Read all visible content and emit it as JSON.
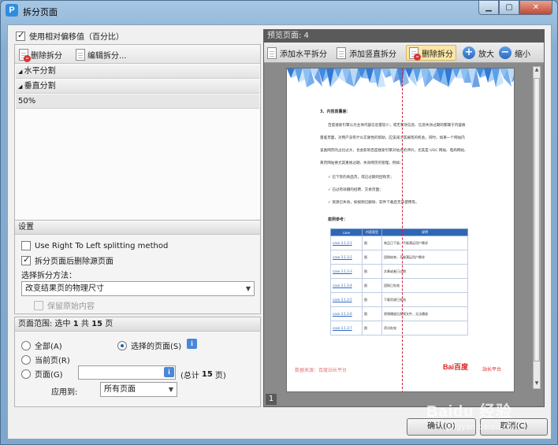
{
  "window": {
    "title": "拆分页面",
    "app_icon": "P"
  },
  "left": {
    "use_relative": "使用相对偏移值（百分比）",
    "toolbar": {
      "delete": "删除拆分",
      "edit": "编辑拆分..."
    },
    "tree": [
      "水平分割",
      "垂直分割",
      "50%"
    ]
  },
  "settings": {
    "header": "设置",
    "rtl": "Use Right To Left splitting method",
    "delete_source": "拆分页面后删除源页面",
    "method_label": "选择拆分方法：",
    "method_value": "改变结果页的物理尺寸",
    "keep_content": "保留原始内容"
  },
  "range": {
    "header_prefix": "页面范围: 选中",
    "selected": "1",
    "of": "共",
    "total": "15",
    "suffix": "页",
    "all": "全部(A)",
    "selected_pages": "选择的页面(S)",
    "current": "当前页(R)",
    "pages": "页面(G)",
    "total_prefix": "(总计",
    "total_suffix": "页)",
    "apply_label": "应用到:",
    "apply_value": "所有页面"
  },
  "preview": {
    "header": "预览页面: 4",
    "add_h": "添加水平拆分",
    "add_v": "添加竖直拆分",
    "delete": "删除拆分",
    "zoom_in": "放大",
    "zoom_out": "缩小",
    "page_num": "1",
    "doc": {
      "heading": "3、内容质量差：",
      "p1": "百度搜索引擎认为主体内容信息量较少，或无有效信息、信息失效过期的都属于内容质",
      "p2": "量差页面，对用户没有什么实质性的帮助，应该减少其展现的机会。同时，如果一个网站内",
      "p3": "该类网页的占比过大，也会影响百度搜索引擎对站点的评价，尤其是 UGC 网站、电商网站、",
      "p4": "黄页网站要尤其重视过期、失效网页的管理，例如：",
      "b1": "已下架的商品页，或已过期的团购页；",
      "b2": "已过有效期的招聘、交易页面；",
      "b3": "资源已失效，如视频已删除、软件下载后无法使用等。",
      "case_head": "案例参考：",
      "table_header": [
        "case",
        "内容类型",
        "说明"
      ],
      "rows": [
        [
          "case 3.1.3-1",
          "图",
          "商品已下架，不能满足用户需求"
        ],
        [
          "case 3.1.3-2",
          "图",
          "团购结束，不能满足用户需求"
        ],
        [
          "case 3.1.3-3",
          "图",
          "文章或者已过期"
        ],
        [
          "case 3.1.3-4",
          "图",
          "团购已失效"
        ],
        [
          "case 3.1.3-5",
          "图",
          "下载资源已失效"
        ],
        [
          "case 3.1.3-6",
          "图",
          "视频播放后视频文件，无法播放"
        ],
        [
          "case 3.1.3-7",
          "图",
          "资讯失效"
        ]
      ],
      "footer_left": "数据来源：百度站长平台",
      "logo": "Bai百度",
      "logo_sub": "站长平台"
    }
  },
  "buttons": {
    "ok": "确认(O)",
    "cancel": "取消(C)"
  },
  "watermark": {
    "text": "Baidu 经验",
    "url": "jingyan.baidu.com"
  },
  "colors": {
    "accent": "#2f8de0",
    "split_line": "#c8233c",
    "table_head": "#2f67b6"
  }
}
